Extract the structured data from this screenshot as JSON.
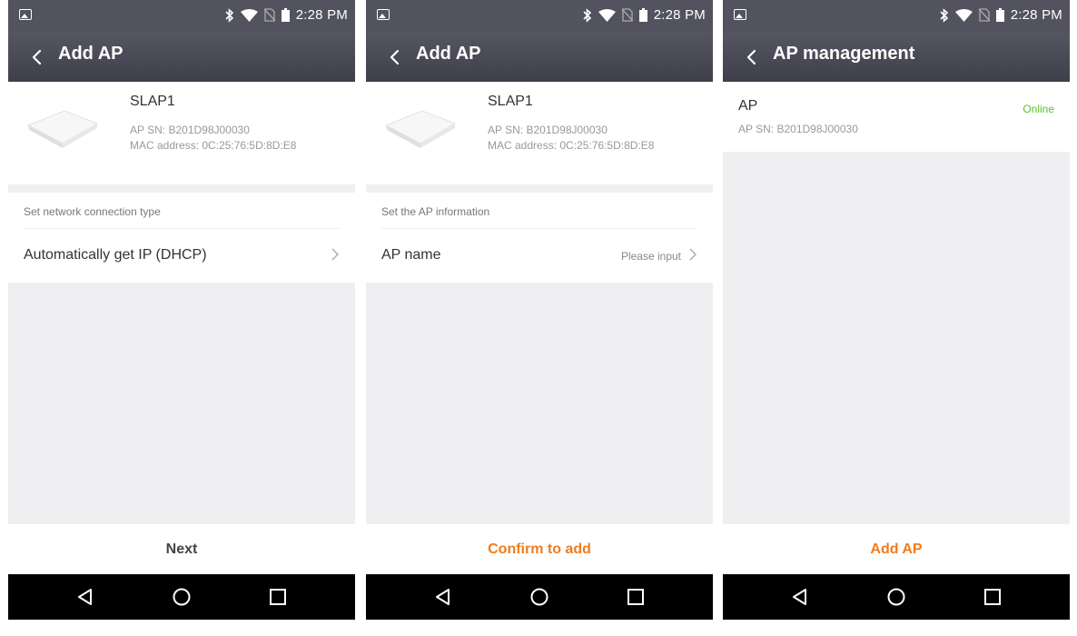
{
  "status_bar": {
    "time": "2:28 PM"
  },
  "colors": {
    "accent": "#f07c1e",
    "online": "#5bbf2f",
    "topbar": "#4a4a57",
    "background": "#efeff1"
  },
  "screens": [
    {
      "title": "Add AP",
      "device": {
        "name": "SLAP1",
        "sn": "AP SN: B201D98J00030",
        "mac": "MAC address: 0C:25:76:5D:8D:E8"
      },
      "section_label": "Set network connection type",
      "row_label": "Automatically get IP (DHCP)",
      "row_value": "",
      "bottom_button": "Next"
    },
    {
      "title": "Add AP",
      "device": {
        "name": "SLAP1",
        "sn": "AP SN: B201D98J00030",
        "mac": "MAC address: 0C:25:76:5D:8D:E8"
      },
      "section_label": "Set the AP information",
      "row_label": "AP name",
      "row_value": "Please input",
      "bottom_button": "Confirm to add"
    },
    {
      "title": "AP management",
      "ap": {
        "name": "AP",
        "sn": "AP SN: B201D98J00030",
        "status": "Online"
      },
      "bottom_button": "Add AP"
    }
  ],
  "icons": [
    "image-icon",
    "bluetooth-icon",
    "wifi-icon",
    "no-sim-icon",
    "battery-icon",
    "back-chevron-icon",
    "ap-device-image",
    "chevron-right-icon",
    "nav-back-icon",
    "nav-home-icon",
    "nav-recents-icon"
  ]
}
